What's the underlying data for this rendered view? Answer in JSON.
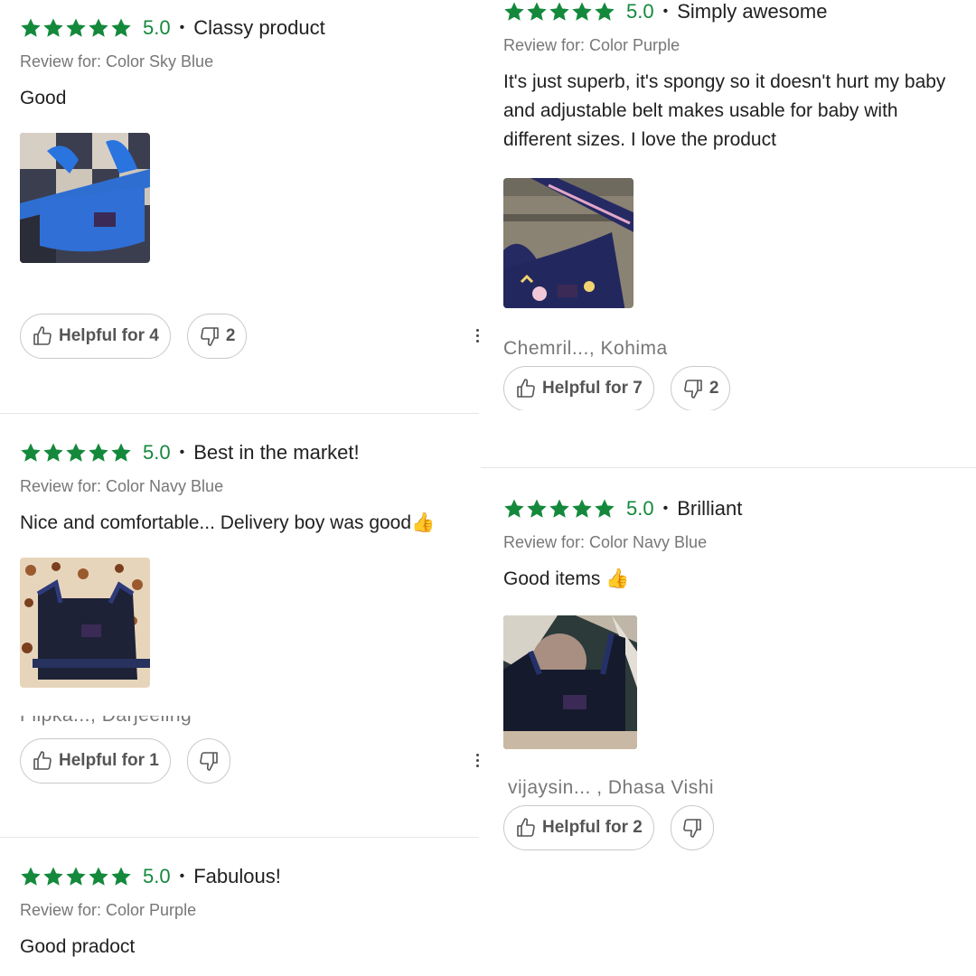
{
  "reviews": [
    {
      "rating": "5.0",
      "title": "Classy product",
      "variant": "Review for: Color Sky Blue",
      "text": "Good",
      "author": "",
      "helpful": "Helpful for 4",
      "unhelpful": "2"
    },
    {
      "rating": "5.0",
      "title": "Simply awesome",
      "variant": "Review for: Color Purple",
      "text": "It's just superb, it's spongy so it doesn't hurt my baby and adjustable belt makes usable for baby with different sizes. I love the product",
      "author": "Chemril..., Kohima",
      "helpful": "Helpful for 7",
      "unhelpful": "2"
    },
    {
      "rating": "5.0",
      "title": "Best in the market!",
      "variant": "Review for: Color Navy Blue",
      "text": "Nice and comfortable... Delivery boy was good👍",
      "author": "Flipka..., Darjeeling",
      "helpful": "Helpful for 1",
      "unhelpful": ""
    },
    {
      "rating": "5.0",
      "title": "Brilliant",
      "variant": "Review for: Color Navy Blue",
      "text": "Good items 👍",
      "author": "vijaysin... , Dhasa Vishi",
      "helpful": "Helpful for 2",
      "unhelpful": ""
    },
    {
      "rating": "5.0",
      "title": "Fabulous!",
      "variant": "Review for: Color Purple",
      "text": "Good pradoct",
      "author": "",
      "helpful": "",
      "unhelpful": ""
    }
  ],
  "colors": {
    "star": "#14893c",
    "rating": "#14893c",
    "secondary": "#777777"
  }
}
